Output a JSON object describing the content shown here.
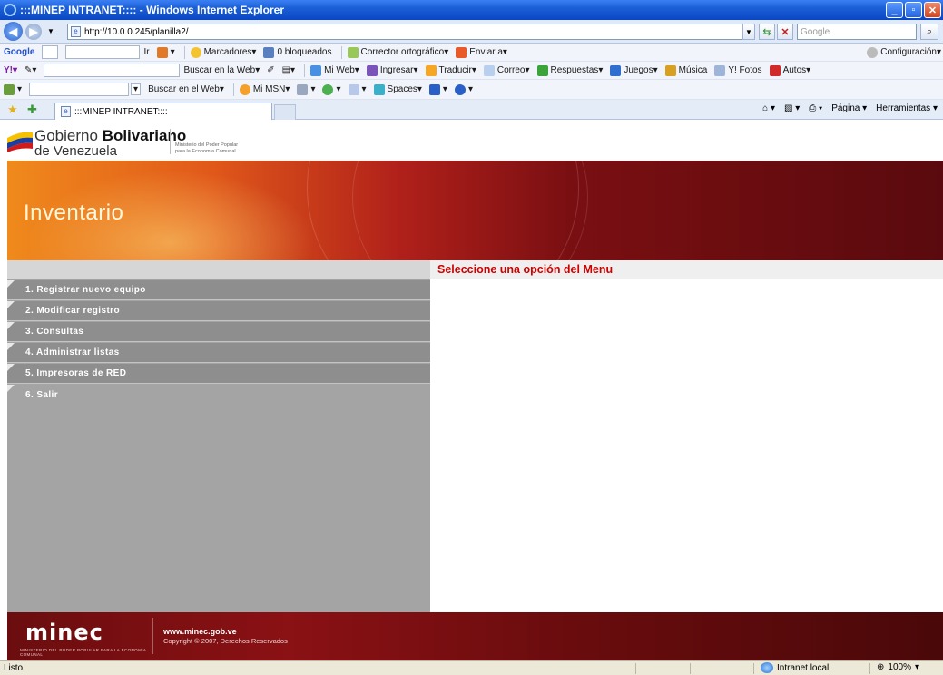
{
  "window": {
    "title": ":::MINEP INTRANET:::: - Windows Internet Explorer"
  },
  "address": {
    "url": "http://10.0.0.245/planilla2/",
    "search_placeholder": "Google"
  },
  "toolbar_google": {
    "brand": "Google",
    "ir": "Ir",
    "marcadores": "Marcadores",
    "bloqueados": "0 bloqueados",
    "corrector": "Corrector ortográfico",
    "enviar": "Enviar a",
    "configuracion": "Configuración"
  },
  "toolbar_yahoo": {
    "buscar_web": "Buscar en la Web",
    "mi_web": "Mi Web",
    "ingresar": "Ingresar",
    "traducir": "Traducir",
    "correo": "Correo",
    "respuestas": "Respuestas",
    "juegos": "Juegos",
    "musica": "Música",
    "fotos": "Y! Fotos",
    "autos": "Autos"
  },
  "toolbar_msn": {
    "buscar_web": "Buscar en el Web",
    "mi_msn": "Mi MSN",
    "spaces": "Spaces"
  },
  "tabs": {
    "active_tab": ":::MINEP INTRANET::::",
    "pagina": "Página",
    "herramientas": "Herramientas"
  },
  "header": {
    "gov_line1_a": "Gobierno ",
    "gov_line1_b": "Bolivariano",
    "gov_line2": "de Venezuela",
    "ministry_line1": "Ministerio del Poder Popular",
    "ministry_line2": "para la Economía Comunal"
  },
  "banner": {
    "title": "Inventario"
  },
  "menu": {
    "items": [
      {
        "label": "1. Registrar nuevo equipo"
      },
      {
        "label": "2. Modificar registro"
      },
      {
        "label": "3. Consultas"
      },
      {
        "label": "4. Administrar listas"
      },
      {
        "label": "5. Impresoras de RED"
      },
      {
        "label": "6. Salir"
      }
    ]
  },
  "content": {
    "heading": "Seleccione una opción del Menu"
  },
  "footer": {
    "logo": "minec",
    "logo_sub": "MINISTERIO DEL PODER POPULAR PARA LA ECONOMIA COMUNAL",
    "url": "www.minec.gob.ve",
    "copyright": "Copyright © 2007, Derechos Reservados"
  },
  "statusbar": {
    "status": "Listo",
    "zone": "Intranet local",
    "zoom": "100%"
  },
  "colors": {
    "menu_item": "#8e8e8e",
    "menu_panel": "#a4a4a4",
    "heading_red": "#cc0000",
    "footer": "#6b0d0f"
  }
}
